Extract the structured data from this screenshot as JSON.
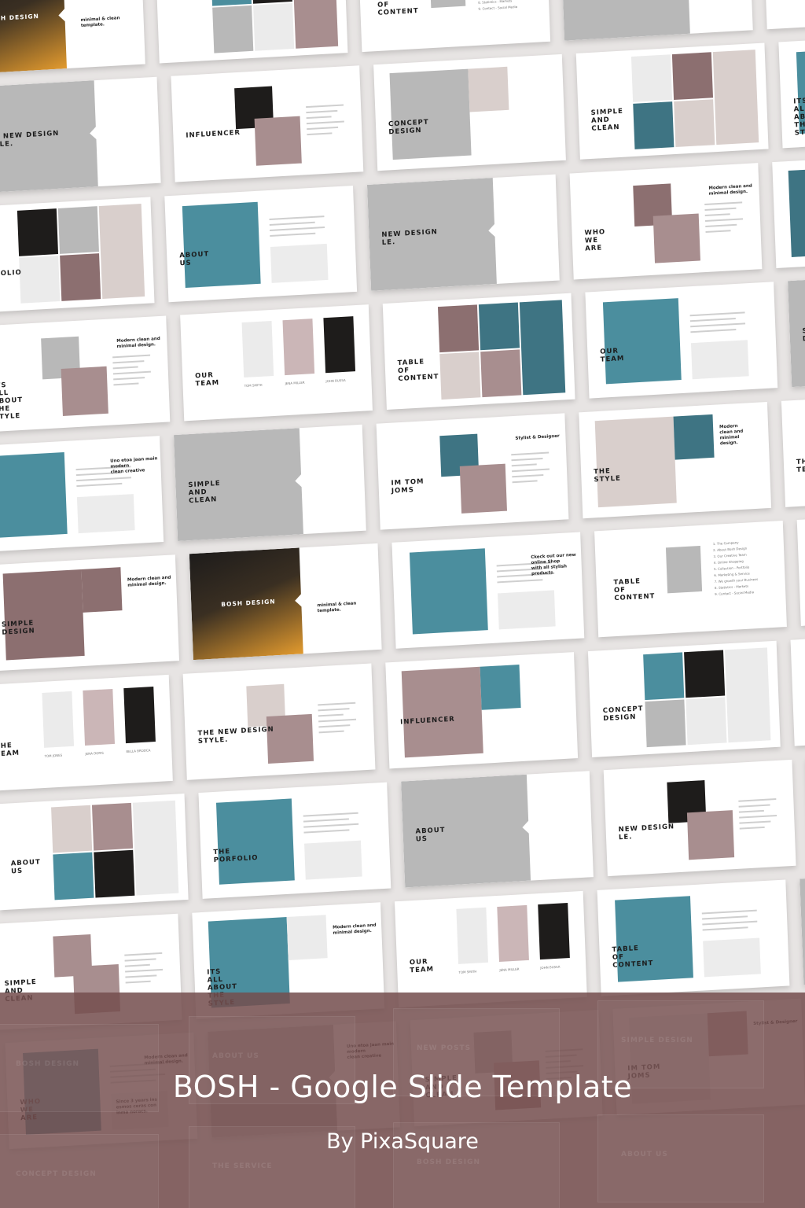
{
  "banner": {
    "title": "BOSH - Google Slide Template",
    "subtitle": "By PixaSquare"
  },
  "colors": {
    "banner": "#744e4e",
    "mauve": "#a88e8f",
    "teal": "#4b8e9e",
    "dark": "#1e1c1b",
    "orange": "#e29a2e",
    "gray": "#b8b8b8",
    "light": "#ebebeb"
  },
  "slides": [
    {
      "kind": "cover",
      "title": "BOSH DESIGN",
      "caption": "minimal & clean\ntemplate."
    },
    {
      "kind": "text",
      "title": "TABLE\nOF\nCONTENT"
    },
    {
      "kind": "text",
      "title": "SIMPLE\nAND\nCLEAN"
    },
    {
      "kind": "text",
      "title": "THE NEW DESIGN\nSTYLE."
    },
    {
      "kind": "text",
      "title": "IM TOM\nJOMS",
      "caption": "Stylist & Designer"
    },
    {
      "kind": "text",
      "title": "WHO\nWE\nARE",
      "caption": "Modern clean and\nminimal design.",
      "note": "Since 3 years ins\nesmos ceras con\ninma noracs."
    },
    {
      "kind": "text",
      "title": "THE\nPORFOLIO"
    },
    {
      "kind": "text",
      "caption": "Ckeck out our new online Shop\nwith all stylish products."
    },
    {
      "kind": "text",
      "title": "OUR\nTEAM"
    },
    {
      "kind": "text",
      "title": "ITS\nALL\nABOUT\nTHE\nSTYLE",
      "caption": "Modern clean and\nminimal design."
    },
    {
      "kind": "text",
      "title": "INFLUENCER"
    },
    {
      "kind": "text",
      "title": "THE\nSTYLE",
      "caption": "Modern\nclean and\nminimal\ndesign."
    },
    {
      "kind": "text",
      "caption": "Uno etoa jaan main modern\nclean creative"
    },
    {
      "kind": "text",
      "title": "ABOUT\nUS"
    },
    {
      "kind": "toc",
      "title": "TABLE\nOF\nCONTENT",
      "items": [
        "1. The Company",
        "2. About Bosh Design",
        "3. Our Creative Team",
        "4. Online Shopping",
        "5. Collection - Portfolio",
        "6. Marketing & Service",
        "7. We growth your Business",
        "8. Statistics - Markets",
        "9. Contact - Social Media"
      ]
    },
    {
      "kind": "text",
      "title": "SIMPLE\nDESIGN",
      "caption": "Modern clean and\nminimal design."
    },
    {
      "kind": "team",
      "title": "OUR\nTEAM",
      "names": [
        "TOM SMITH",
        "JENA MILLER",
        "JOHN BUSSA"
      ]
    },
    {
      "kind": "text",
      "title": "CONCEPT\nDESIGN"
    },
    {
      "kind": "team",
      "title": "THE\nTEAM",
      "names": [
        "TOM JONES",
        "JENA DORIS",
        "BELLA BRODCA"
      ]
    },
    {
      "kind": "text",
      "title": "SIMPLE\nAND\nCLEAN"
    },
    {
      "kind": "text",
      "title": "NEW DESIGN\nLE."
    },
    {
      "kind": "text",
      "title": "ABOUT\nUS"
    }
  ],
  "ghost": {
    "words": [
      "BOSH DESIGN",
      "ABOUT\nUS",
      "NEW POSTS",
      "SIMPLE\nDESIGN",
      "CONCEPT\nDESIGN",
      "THE\nSERVICE"
    ],
    "captions": [
      "Modern clean and\nminimal design.",
      "minimal & clean\ntemplate."
    ]
  }
}
